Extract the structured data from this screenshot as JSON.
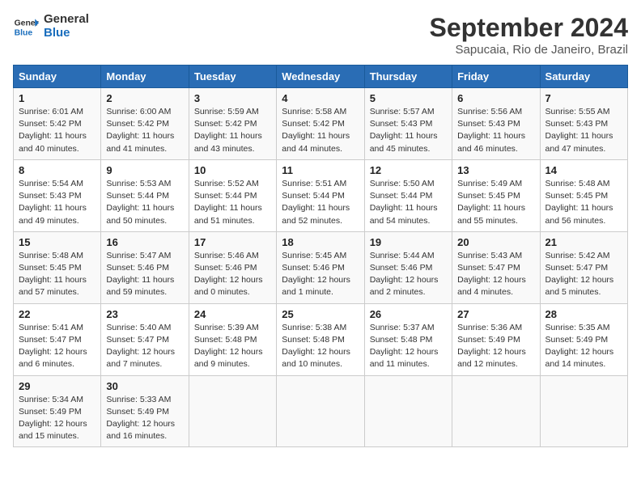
{
  "logo": {
    "line1": "General",
    "line2": "Blue"
  },
  "title": "September 2024",
  "subtitle": "Sapucaia, Rio de Janeiro, Brazil",
  "days_header": [
    "Sunday",
    "Monday",
    "Tuesday",
    "Wednesday",
    "Thursday",
    "Friday",
    "Saturday"
  ],
  "weeks": [
    [
      {
        "day": "1",
        "info": "Sunrise: 6:01 AM\nSunset: 5:42 PM\nDaylight: 11 hours\nand 40 minutes."
      },
      {
        "day": "2",
        "info": "Sunrise: 6:00 AM\nSunset: 5:42 PM\nDaylight: 11 hours\nand 41 minutes."
      },
      {
        "day": "3",
        "info": "Sunrise: 5:59 AM\nSunset: 5:42 PM\nDaylight: 11 hours\nand 43 minutes."
      },
      {
        "day": "4",
        "info": "Sunrise: 5:58 AM\nSunset: 5:42 PM\nDaylight: 11 hours\nand 44 minutes."
      },
      {
        "day": "5",
        "info": "Sunrise: 5:57 AM\nSunset: 5:43 PM\nDaylight: 11 hours\nand 45 minutes."
      },
      {
        "day": "6",
        "info": "Sunrise: 5:56 AM\nSunset: 5:43 PM\nDaylight: 11 hours\nand 46 minutes."
      },
      {
        "day": "7",
        "info": "Sunrise: 5:55 AM\nSunset: 5:43 PM\nDaylight: 11 hours\nand 47 minutes."
      }
    ],
    [
      {
        "day": "8",
        "info": "Sunrise: 5:54 AM\nSunset: 5:43 PM\nDaylight: 11 hours\nand 49 minutes."
      },
      {
        "day": "9",
        "info": "Sunrise: 5:53 AM\nSunset: 5:44 PM\nDaylight: 11 hours\nand 50 minutes."
      },
      {
        "day": "10",
        "info": "Sunrise: 5:52 AM\nSunset: 5:44 PM\nDaylight: 11 hours\nand 51 minutes."
      },
      {
        "day": "11",
        "info": "Sunrise: 5:51 AM\nSunset: 5:44 PM\nDaylight: 11 hours\nand 52 minutes."
      },
      {
        "day": "12",
        "info": "Sunrise: 5:50 AM\nSunset: 5:44 PM\nDaylight: 11 hours\nand 54 minutes."
      },
      {
        "day": "13",
        "info": "Sunrise: 5:49 AM\nSunset: 5:45 PM\nDaylight: 11 hours\nand 55 minutes."
      },
      {
        "day": "14",
        "info": "Sunrise: 5:48 AM\nSunset: 5:45 PM\nDaylight: 11 hours\nand 56 minutes."
      }
    ],
    [
      {
        "day": "15",
        "info": "Sunrise: 5:48 AM\nSunset: 5:45 PM\nDaylight: 11 hours\nand 57 minutes."
      },
      {
        "day": "16",
        "info": "Sunrise: 5:47 AM\nSunset: 5:46 PM\nDaylight: 11 hours\nand 59 minutes."
      },
      {
        "day": "17",
        "info": "Sunrise: 5:46 AM\nSunset: 5:46 PM\nDaylight: 12 hours\nand 0 minutes."
      },
      {
        "day": "18",
        "info": "Sunrise: 5:45 AM\nSunset: 5:46 PM\nDaylight: 12 hours\nand 1 minute."
      },
      {
        "day": "19",
        "info": "Sunrise: 5:44 AM\nSunset: 5:46 PM\nDaylight: 12 hours\nand 2 minutes."
      },
      {
        "day": "20",
        "info": "Sunrise: 5:43 AM\nSunset: 5:47 PM\nDaylight: 12 hours\nand 4 minutes."
      },
      {
        "day": "21",
        "info": "Sunrise: 5:42 AM\nSunset: 5:47 PM\nDaylight: 12 hours\nand 5 minutes."
      }
    ],
    [
      {
        "day": "22",
        "info": "Sunrise: 5:41 AM\nSunset: 5:47 PM\nDaylight: 12 hours\nand 6 minutes."
      },
      {
        "day": "23",
        "info": "Sunrise: 5:40 AM\nSunset: 5:47 PM\nDaylight: 12 hours\nand 7 minutes."
      },
      {
        "day": "24",
        "info": "Sunrise: 5:39 AM\nSunset: 5:48 PM\nDaylight: 12 hours\nand 9 minutes."
      },
      {
        "day": "25",
        "info": "Sunrise: 5:38 AM\nSunset: 5:48 PM\nDaylight: 12 hours\nand 10 minutes."
      },
      {
        "day": "26",
        "info": "Sunrise: 5:37 AM\nSunset: 5:48 PM\nDaylight: 12 hours\nand 11 minutes."
      },
      {
        "day": "27",
        "info": "Sunrise: 5:36 AM\nSunset: 5:49 PM\nDaylight: 12 hours\nand 12 minutes."
      },
      {
        "day": "28",
        "info": "Sunrise: 5:35 AM\nSunset: 5:49 PM\nDaylight: 12 hours\nand 14 minutes."
      }
    ],
    [
      {
        "day": "29",
        "info": "Sunrise: 5:34 AM\nSunset: 5:49 PM\nDaylight: 12 hours\nand 15 minutes."
      },
      {
        "day": "30",
        "info": "Sunrise: 5:33 AM\nSunset: 5:49 PM\nDaylight: 12 hours\nand 16 minutes."
      },
      null,
      null,
      null,
      null,
      null
    ]
  ]
}
